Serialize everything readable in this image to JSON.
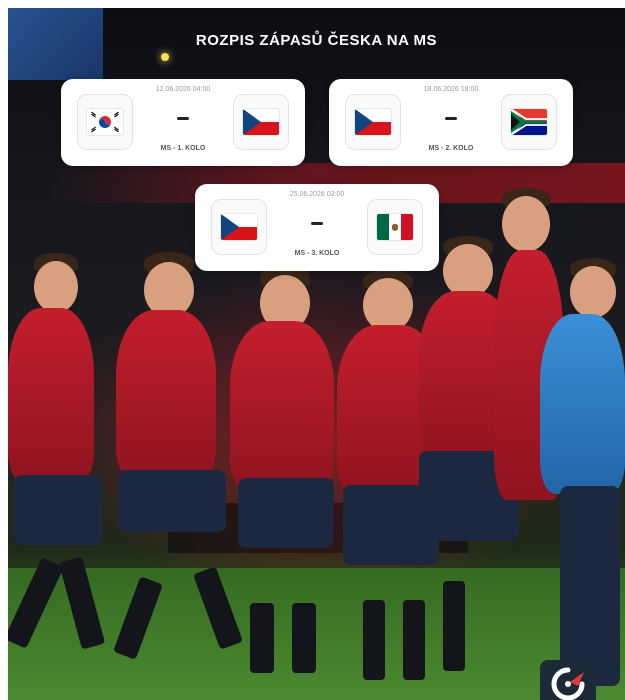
{
  "header": {
    "title": "ROZPIS ZÁPASŮ ČESKA NA MS"
  },
  "matches": [
    {
      "datetime": "12.06.2026 04:00",
      "separator": "–",
      "stage": "MS - 1. KOLO",
      "home_flag": "south-korea-flag",
      "away_flag": "czechia-flag"
    },
    {
      "datetime": "18.06.2026 18:00",
      "separator": "–",
      "stage": "MS - 2. KOLO",
      "home_flag": "czechia-flag",
      "away_flag": "south-africa-flag"
    },
    {
      "datetime": "25.06.2026 03:00",
      "separator": "–",
      "stage": "MS - 3. KOLO",
      "home_flag": "czechia-flag",
      "away_flag": "mexico-flag"
    }
  ],
  "colors": {
    "czech_red": "#d7141a",
    "czech_blue": "#11457e",
    "white": "#ffffff",
    "korea_red": "#cd2e3a",
    "korea_blue": "#0047a0",
    "sa_green": "#007749",
    "sa_gold": "#ffb81c",
    "sa_red": "#e03c31",
    "sa_blue": "#001489",
    "mexico_green": "#006847",
    "mexico_red": "#ce1126",
    "kit_red": "#c41e2d",
    "kit_navy": "#1c2740"
  },
  "icons": [
    "app-logo-icon"
  ]
}
